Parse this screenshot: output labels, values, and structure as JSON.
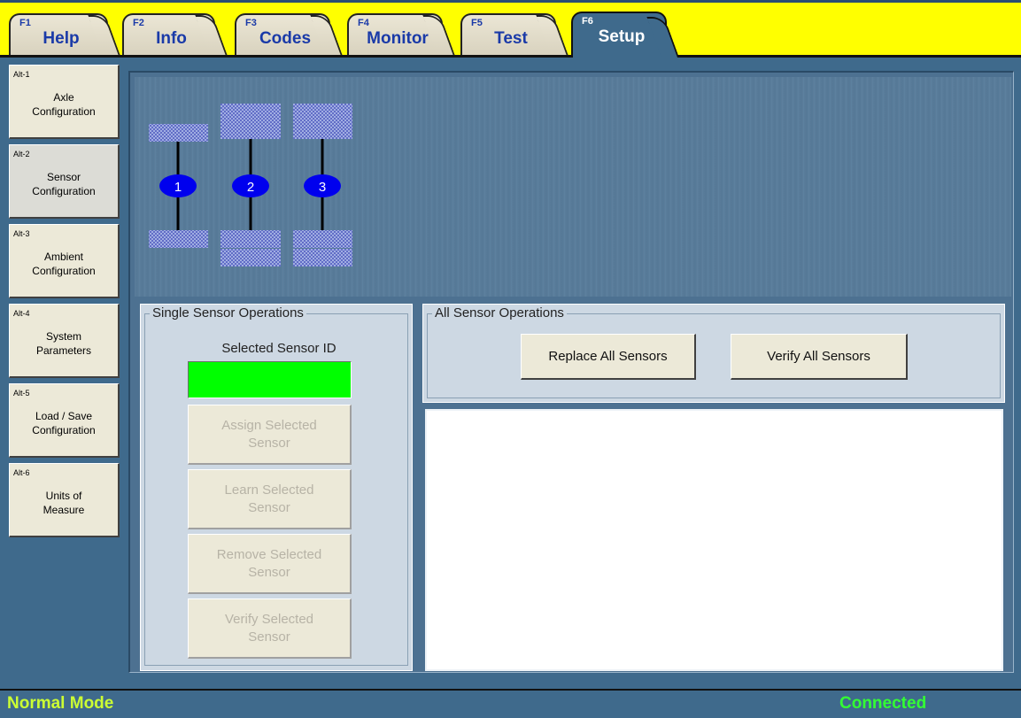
{
  "tabs": [
    {
      "key": "F1",
      "label": "Help"
    },
    {
      "key": "F2",
      "label": "Info"
    },
    {
      "key": "F3",
      "label": "Codes"
    },
    {
      "key": "F4",
      "label": "Monitor"
    },
    {
      "key": "F5",
      "label": "Test"
    },
    {
      "key": "F6",
      "label": "Setup",
      "active": true
    }
  ],
  "sidebar": {
    "items": [
      {
        "alt": "Alt-1",
        "label": "Axle\nConfiguration"
      },
      {
        "alt": "Alt-2",
        "label": "Sensor\nConfiguration",
        "active": true
      },
      {
        "alt": "Alt-3",
        "label": "Ambient\nConfiguration"
      },
      {
        "alt": "Alt-4",
        "label": "System\nParameters"
      },
      {
        "alt": "Alt-5",
        "label": "Load / Save\nConfiguration"
      },
      {
        "alt": "Alt-6",
        "label": "Units of\nMeasure"
      }
    ]
  },
  "axles": [
    {
      "number": "1",
      "dual": false
    },
    {
      "number": "2",
      "dual": true
    },
    {
      "number": "3",
      "dual": true
    }
  ],
  "single_ops": {
    "title": "Single Sensor Operations",
    "selected_id_label": "Selected Sensor ID",
    "selected_id_value": "",
    "buttons": [
      {
        "label": "Assign Selected\nSensor",
        "enabled": false
      },
      {
        "label": "Learn Selected\nSensor",
        "enabled": false
      },
      {
        "label": "Remove Selected\nSensor",
        "enabled": false
      },
      {
        "label": "Verify Selected\nSensor",
        "enabled": false
      }
    ]
  },
  "all_ops": {
    "title": "All Sensor Operations",
    "replace_label": "Replace All Sensors",
    "verify_label": "Verify All Sensors"
  },
  "output_text": "",
  "status": {
    "mode": "Normal Mode",
    "connection": "Connected"
  },
  "colors": {
    "topbar": "#ffff00",
    "panel": "#3f6a8c",
    "sensor_id_field": "#00ff00",
    "axle_badge": "#0000ee",
    "status_mode": "#ccff33",
    "status_connected": "#33ff33"
  }
}
